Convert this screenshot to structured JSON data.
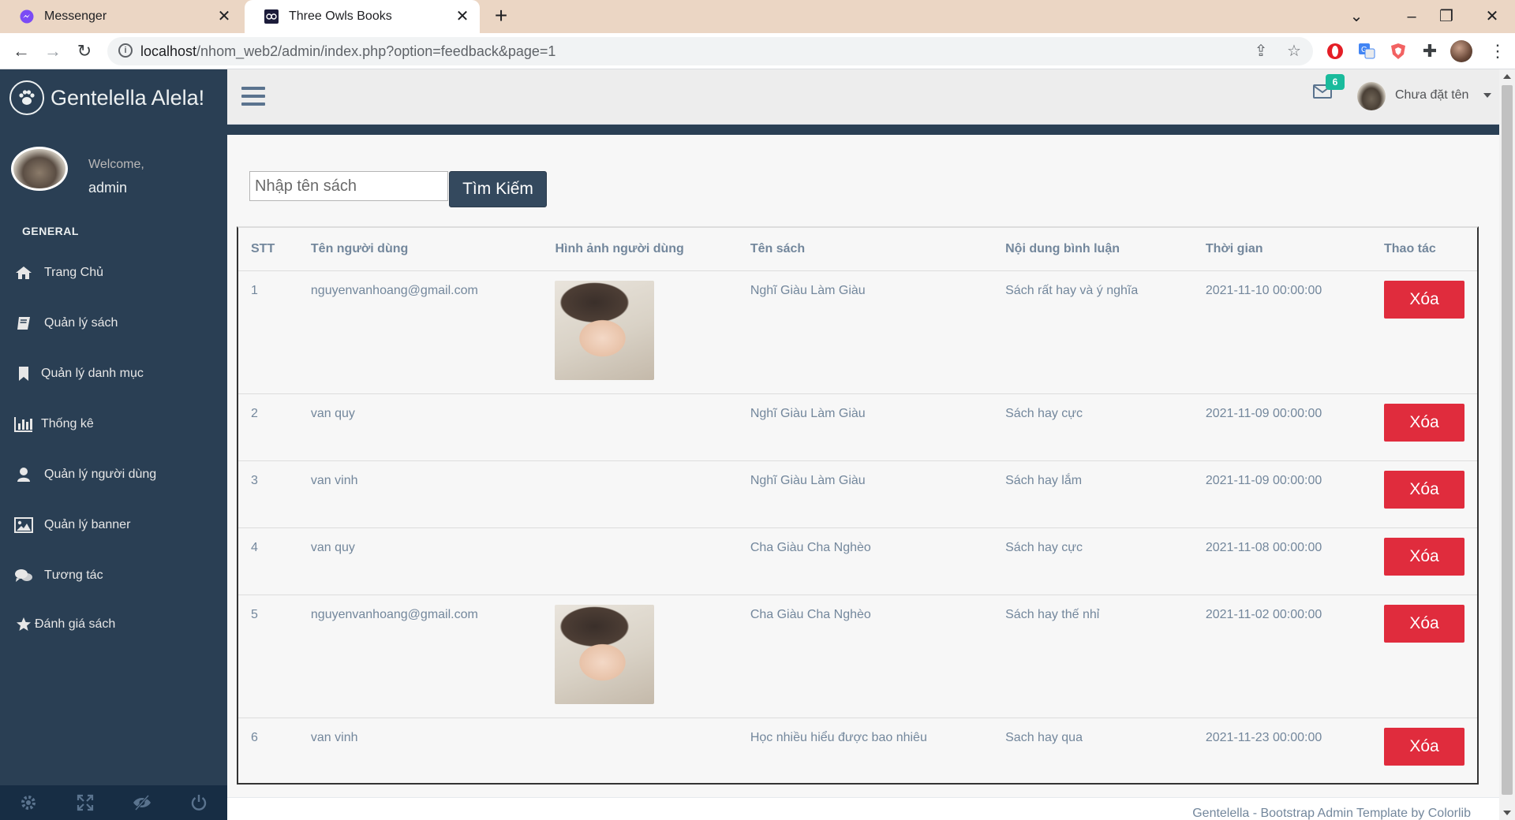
{
  "browser": {
    "tabs": [
      {
        "title": "Messenger",
        "active": false
      },
      {
        "title": "Three Owls Books",
        "active": true
      }
    ],
    "url_host": "localhost",
    "url_path": "/nhom_web2/admin/index.php?option=feedback&page=1"
  },
  "sidebar": {
    "brand": "Gentelella Alela!",
    "welcome": "Welcome,",
    "username": "admin",
    "section_title": "GENERAL",
    "items": [
      {
        "label": "Trang Chủ",
        "icon": "home-icon"
      },
      {
        "label": "Quản lý sách",
        "icon": "book-icon"
      },
      {
        "label": "Quản lý danh mục",
        "icon": "bookmark-icon"
      },
      {
        "label": "Thống kê",
        "icon": "bar-chart-icon"
      },
      {
        "label": "Quản lý người dùng",
        "icon": "user-icon"
      },
      {
        "label": "Quản lý banner",
        "icon": "image-icon"
      },
      {
        "label": "Tương tác",
        "icon": "comments-icon"
      },
      {
        "label": "Đánh giá sách",
        "icon": "star-icon"
      }
    ],
    "footer_icons": [
      "settings-icon",
      "fullscreen-icon",
      "eye-slash-icon",
      "power-icon"
    ]
  },
  "topnav": {
    "mail_count": "6",
    "user_name": "Chưa đặt tên"
  },
  "search": {
    "placeholder": "Nhập tên sách",
    "button_label": "Tìm Kiếm"
  },
  "table": {
    "headers": [
      "STT",
      "Tên người dùng",
      "Hình ảnh người dùng",
      "Tên sách",
      "Nội dung bình luận",
      "Thời gian",
      "Thao tác"
    ],
    "rows": [
      {
        "stt": "1",
        "user": "nguyenvanhoang@gmail.com",
        "has_image": true,
        "book": "Nghĩ Giàu Làm Giàu",
        "comment": "Sách rất hay và ý nghĩa",
        "time": "2021-11-10 00:00:00",
        "action": "Xóa"
      },
      {
        "stt": "2",
        "user": "van quy",
        "has_image": false,
        "book": "Nghĩ Giàu Làm Giàu",
        "comment": "Sách hay cực",
        "time": "2021-11-09 00:00:00",
        "action": "Xóa"
      },
      {
        "stt": "3",
        "user": "van vinh",
        "has_image": false,
        "book": "Nghĩ Giàu Làm Giàu",
        "comment": "Sách hay lắm",
        "time": "2021-11-09 00:00:00",
        "action": "Xóa"
      },
      {
        "stt": "4",
        "user": "van quy",
        "has_image": false,
        "book": "Cha Giàu Cha Nghèo",
        "comment": "Sách hay cực",
        "time": "2021-11-08 00:00:00",
        "action": "Xóa"
      },
      {
        "stt": "5",
        "user": "nguyenvanhoang@gmail.com",
        "has_image": true,
        "book": "Cha Giàu Cha Nghèo",
        "comment": "Sách hay thế nhỉ",
        "time": "2021-11-02 00:00:00",
        "action": "Xóa"
      },
      {
        "stt": "6",
        "user": "van vinh",
        "has_image": false,
        "book": "Học nhiều hiểu được bao nhiêu",
        "comment": "Sach hay qua",
        "time": "2021-11-23 00:00:00",
        "action": "Xóa"
      }
    ]
  },
  "footer": {
    "text": "Gentelella - Bootstrap Admin Template by Colorlib"
  },
  "colors": {
    "sidebar_bg": "#2A3F54",
    "delete_button": "#E02C3D",
    "search_button": "#34495E",
    "badge": "#1ABB9C"
  }
}
